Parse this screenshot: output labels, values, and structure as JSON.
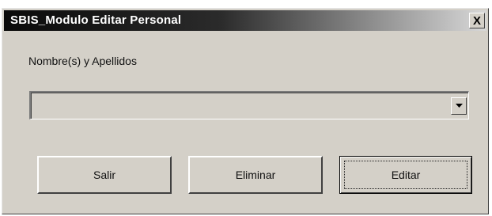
{
  "window": {
    "title": "SBIS_Modulo Editar Personal",
    "close_glyph": "X"
  },
  "form": {
    "name_label": "Nombre(s) y Apellidos",
    "name_select": {
      "value": "",
      "icon": "chevron-down-icon"
    }
  },
  "buttons": {
    "salir": "Salir",
    "eliminar": "Eliminar",
    "editar": "Editar"
  },
  "colors": {
    "window_bg": "#d4d0c8",
    "titlebar_start": "#0a0a0a",
    "titlebar_end": "#d8d8d8"
  }
}
